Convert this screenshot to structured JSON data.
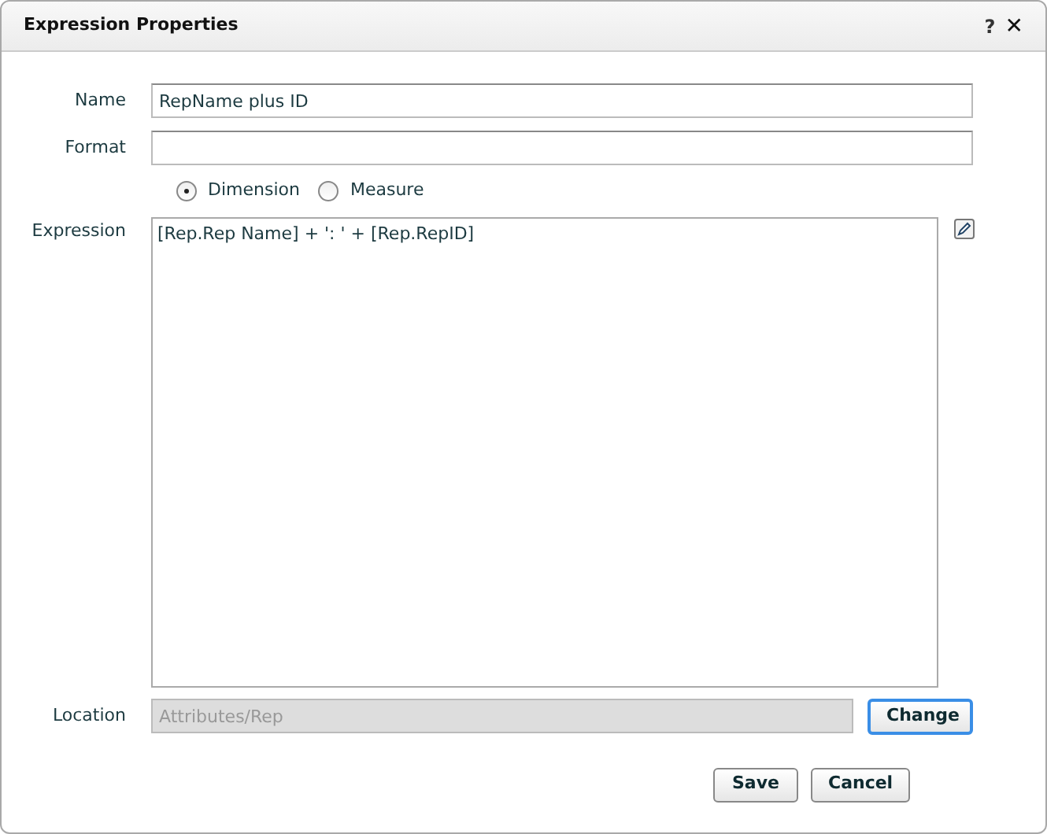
{
  "window": {
    "title": "Expression Properties",
    "help": "?",
    "close": "✕"
  },
  "name": {
    "label": "Name",
    "value": "RepName plus ID"
  },
  "format": {
    "label": "Format"
  },
  "type_options": [
    {
      "label": "Dimension",
      "selected": true
    },
    {
      "label": "Measure",
      "selected": false
    }
  ],
  "expression": {
    "label": "Expression",
    "value": "[Rep.Rep Name] + ': ' + [Rep.RepID]"
  },
  "location": {
    "label": "Location",
    "value": "Attributes/Rep",
    "disabled": true,
    "button": "Change",
    "button_focused": true
  },
  "buttons": [
    "Save",
    "Cancel"
  ]
}
